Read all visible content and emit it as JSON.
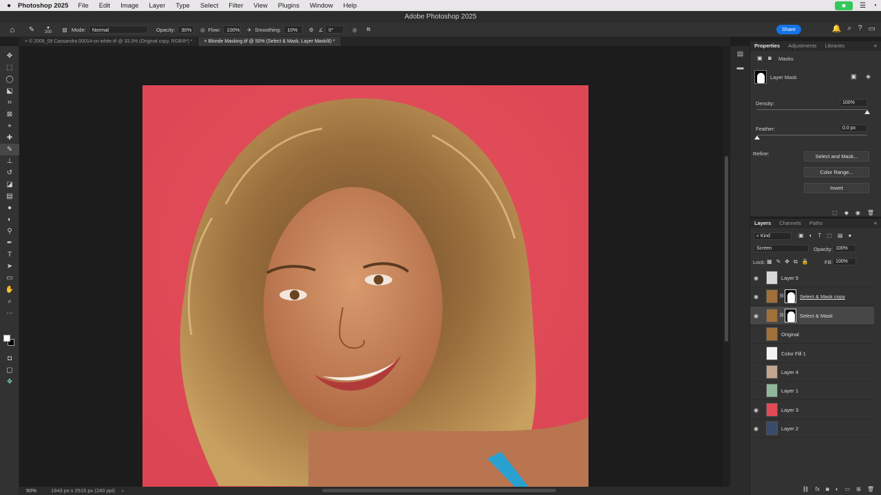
{
  "menubar": {
    "apple": "",
    "app_name": "Photoshop 2025",
    "items": [
      "File",
      "Edit",
      "Image",
      "Layer",
      "Type",
      "Select",
      "Filter",
      "View",
      "Plugins",
      "Window",
      "Help"
    ]
  },
  "window_title": "Adobe Photoshop 2025",
  "options": {
    "brush_size": "200",
    "mode_label": "Mode:",
    "mode_value": "Normal",
    "opacity_label": "Opacity:",
    "opacity_value": "30%",
    "flow_label": "Flow:",
    "flow_value": "100%",
    "smoothing_label": "Smoothing:",
    "smoothing_value": "10%",
    "angle_value": "0°",
    "share_label": "Share"
  },
  "doc_tabs": [
    {
      "label": "© 2008_09 Cassandra 00014-on white.tif @ 33.3% (Original copy, RGB/8*) *",
      "active": false
    },
    {
      "label": "Blonde Masking.tif @ 50% (Select & Mask, Layer Mask/8) *",
      "active": true
    }
  ],
  "status": {
    "zoom": "50%",
    "doc_info": "1943 px x 2515 px (240 ppi)"
  },
  "properties": {
    "tabs": [
      "Properties",
      "Adjustments",
      "Libraries"
    ],
    "masks_label": "Masks",
    "layer_mask_label": "Layer Mask",
    "density_label": "Density:",
    "density_value": "100%",
    "density_level": 100,
    "feather_label": "Feather:",
    "feather_value": "0.0 px",
    "refine_label": "Refine:",
    "buttons": {
      "select_and_mask": "Select and Mask...",
      "color_range": "Color Range...",
      "invert": "Invert"
    }
  },
  "layers_panel": {
    "tabs": [
      "Layers",
      "Channels",
      "Paths"
    ],
    "filter_kind": "Kind",
    "blend_mode": "Screen",
    "opacity_label": "Opacity:",
    "opacity_value": "100%",
    "lock_label": "Lock:",
    "fill_label": "Fill:",
    "fill_value": "100%",
    "layers": [
      {
        "name": "Layer 5",
        "visible": true,
        "selected": false,
        "thumb": "#d8d8d8",
        "mask": false,
        "underline": false
      },
      {
        "name": "Select & Mask copy",
        "visible": true,
        "selected": false,
        "thumb": "#a0703a",
        "mask": true,
        "underline": true
      },
      {
        "name": "Select & Mask",
        "visible": true,
        "selected": true,
        "thumb": "#a0703a",
        "mask": true,
        "underline": false
      },
      {
        "name": "Original",
        "visible": false,
        "selected": false,
        "thumb": "#a0703a",
        "mask": false,
        "underline": false
      },
      {
        "name": "Color Fill 1",
        "visible": false,
        "selected": false,
        "thumb": "#f4f4f4",
        "mask": false,
        "underline": false
      },
      {
        "name": "Layer 4",
        "visible": false,
        "selected": false,
        "thumb": "#c3a58e",
        "mask": false,
        "underline": false
      },
      {
        "name": "Layer 1",
        "visible": false,
        "selected": false,
        "thumb": "#8fb89a",
        "mask": false,
        "underline": false
      },
      {
        "name": "Layer 3",
        "visible": true,
        "selected": false,
        "thumb": "#e34a55",
        "mask": false,
        "underline": false
      },
      {
        "name": "Layer 2",
        "visible": true,
        "selected": false,
        "thumb": "#3a4a6a",
        "mask": false,
        "underline": false
      }
    ]
  }
}
